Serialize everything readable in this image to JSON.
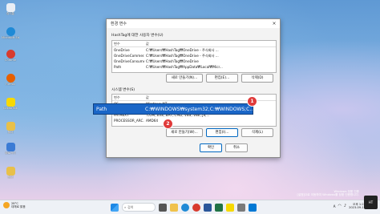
{
  "desktop_icons": [
    {
      "label": "휴지통",
      "color": "#e9eef5"
    },
    {
      "label": "Microsoft Edge",
      "color": "#1f8ad6"
    },
    {
      "label": "Chrome",
      "color": "#d83b2e"
    },
    {
      "label": "Firefox",
      "color": "#e66000"
    },
    {
      "label": "KakaoTalk",
      "color": "#f7d900"
    },
    {
      "label": "폴더",
      "color": "#e8c04a"
    },
    {
      "label": "바로가기",
      "color": "#3a7bd5"
    },
    {
      "label": "폴더",
      "color": "#e8c04a"
    }
  ],
  "dialog": {
    "title": "환경 변수",
    "close_icon": "×",
    "user_section_label": "HashTag에 대한 사용자 변수(U)",
    "user_table": {
      "headers": [
        "변수",
        "값"
      ],
      "rows": [
        [
          "OneDrive",
          "C:₩Users₩HashTag₩OneDrive - 주식회사 ..."
        ],
        [
          "OneDriveCommer...",
          "C:₩Users₩HashTag₩OneDrive - 주식회사 ..."
        ],
        [
          "OneDriveConsumer",
          "C:₩Users₩HashTag₩OneDrive"
        ],
        [
          "Path",
          "C:₩Users₩HashTag₩AppData₩Local₩Micr..."
        ]
      ]
    },
    "user_buttons": {
      "new": "새로 만들기(N)...",
      "edit": "편집(E)...",
      "delete": "삭제(D)"
    },
    "system_section_label": "시스템 변수(S)",
    "system_table": {
      "headers": [
        "변수",
        "값"
      ],
      "rows": [
        [
          "OS",
          "Windows_NT"
        ],
        [
          "Path",
          "C:₩WINDOWS₩system32;C:₩WINDOWS;C:..."
        ],
        [
          "PATHEXT",
          ".COM;.EXE;.BAT;.CMD;.VBS;.VBE;.JS;..."
        ],
        [
          "PROCESSOR_ARC...",
          "AMD64"
        ]
      ]
    },
    "system_buttons": {
      "new": "새로 만들기(W)...",
      "edit": "편집(I)...",
      "delete": "삭제(L)"
    },
    "ok_button": "확인",
    "cancel_button": "취소"
  },
  "highlight_row": {
    "name": "Path",
    "value": "C:₩WINDOWS₩system32;C:₩WINDOWS;C..."
  },
  "badges": {
    "one": "1",
    "two": "2"
  },
  "taskbar": {
    "weather_temp": "28°C",
    "weather_desc": "대체로 맑음",
    "search_placeholder": "검색",
    "language": "A",
    "time": "오후 1:22",
    "date": "2023-09-17"
  },
  "watermark": {
    "line1": "Windows 정품 인증",
    "line2": "[설정]으로 이동하여 Windows를 정품 인증합니다."
  },
  "logo_text": "HT"
}
